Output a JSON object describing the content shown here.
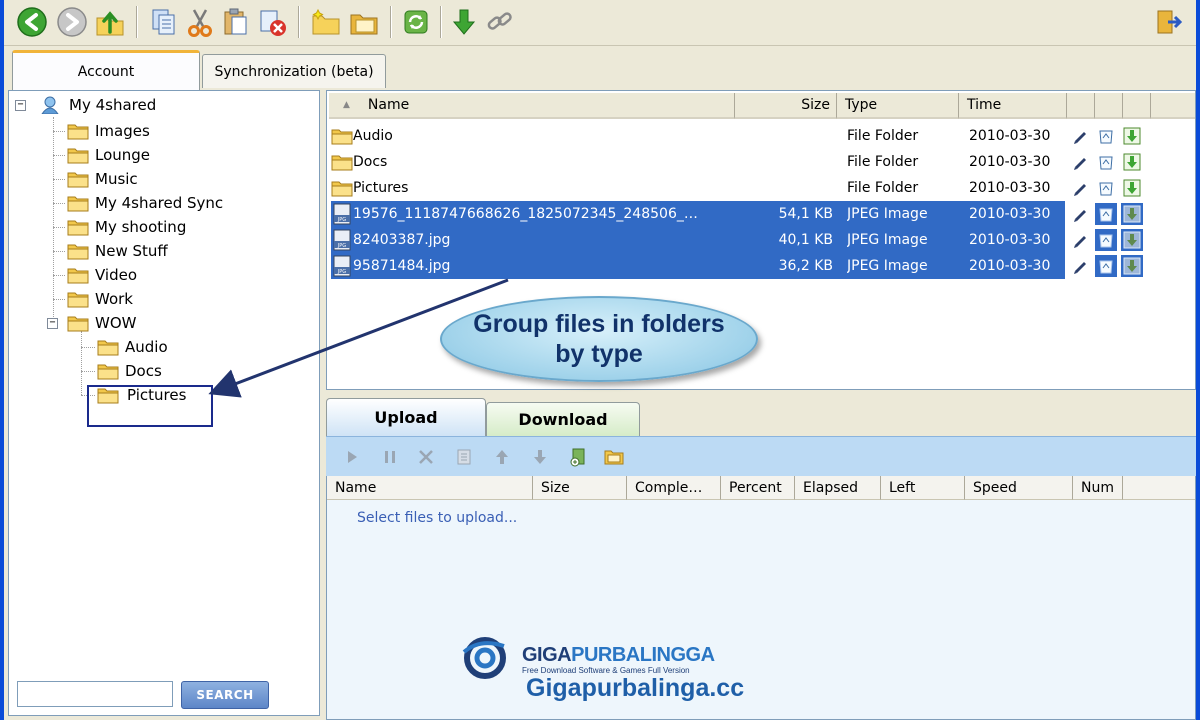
{
  "toolbar": {
    "buttons": [
      "back-icon",
      "forward-icon",
      "up-folder-icon",
      "copy-icon",
      "cut-icon",
      "paste-icon",
      "delete-icon",
      "new-folder-icon",
      "open-folder-icon",
      "refresh-icon",
      "download-icon",
      "link-icon",
      "exit-icon"
    ]
  },
  "left_tabs": [
    {
      "label": "Account",
      "active": true
    },
    {
      "label": "Synchronization (beta)",
      "active": false
    }
  ],
  "tree": {
    "root": "My 4shared",
    "items": [
      {
        "label": "Images",
        "level": 1
      },
      {
        "label": "Lounge",
        "level": 1
      },
      {
        "label": "Music",
        "level": 1
      },
      {
        "label": "My 4shared Sync",
        "level": 1
      },
      {
        "label": "My shooting",
        "level": 1
      },
      {
        "label": "New Stuff",
        "level": 1
      },
      {
        "label": "Video",
        "level": 1
      },
      {
        "label": "Work",
        "level": 1
      },
      {
        "label": "WOW",
        "level": 1,
        "expanded": true
      },
      {
        "label": "Audio",
        "level": 2
      },
      {
        "label": "Docs",
        "level": 2
      },
      {
        "label": "Pictures",
        "level": 2,
        "selected": true
      }
    ]
  },
  "search": {
    "button": "SEARCH",
    "value": ""
  },
  "file_list": {
    "columns": {
      "name": "Name",
      "size": "Size",
      "type": "Type",
      "time": "Time"
    },
    "rows": [
      {
        "name": "Audio",
        "size": "",
        "type": "File Folder",
        "time": "2010-03-30",
        "kind": "folder",
        "selected": false
      },
      {
        "name": "Docs",
        "size": "",
        "type": "File Folder",
        "time": "2010-03-30",
        "kind": "folder",
        "selected": false
      },
      {
        "name": "Pictures",
        "size": "",
        "type": "File Folder",
        "time": "2010-03-30",
        "kind": "folder",
        "selected": false
      },
      {
        "name": "19576_1118747668626_1825072345_248506_…",
        "size": "54,1 KB",
        "type": "JPEG Image",
        "time": "2010-03-30",
        "kind": "jpeg",
        "selected": true
      },
      {
        "name": "82403387.jpg",
        "size": "40,1 KB",
        "type": "JPEG Image",
        "time": "2010-03-30",
        "kind": "jpeg",
        "selected": true
      },
      {
        "name": "95871484.jpg",
        "size": "36,2 KB",
        "type": "JPEG Image",
        "time": "2010-03-30",
        "kind": "jpeg",
        "selected": true
      }
    ]
  },
  "callout": {
    "line1": "Group files in folders",
    "line2": "by type"
  },
  "transfer_tabs": {
    "upload": "Upload",
    "download": "Download"
  },
  "queue": {
    "columns": [
      "Name",
      "Size",
      "Comple…",
      "Percent",
      "Elapsed",
      "Left",
      "Speed",
      "Num"
    ],
    "empty_text": "Select files to upload..."
  },
  "watermark": {
    "brand_part1": "GIGA",
    "brand_part2": "PURBALINGGA",
    "tagline": "Free Download Software & Games Full Version",
    "url": "Gigapurbalinga.cc"
  },
  "colors": {
    "selection": "#316ac5",
    "frame": "#0a4bd8",
    "queue_bg": "#eef6fc"
  }
}
